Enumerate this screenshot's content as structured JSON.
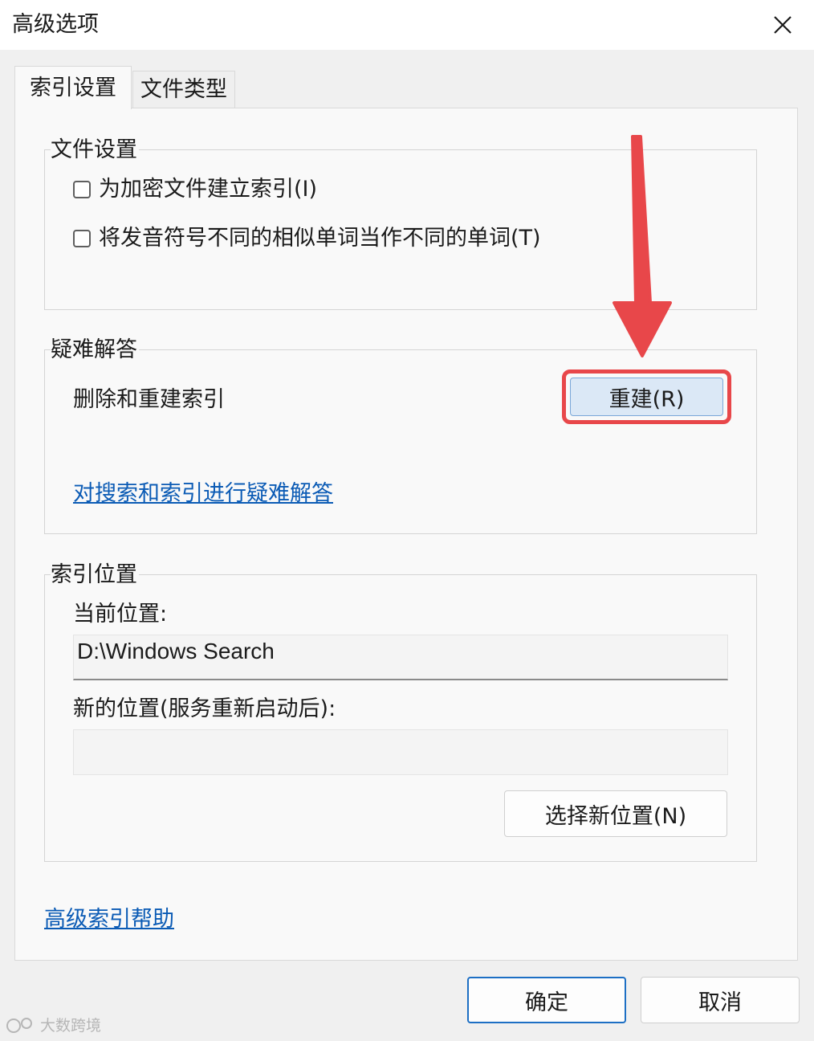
{
  "window": {
    "title": "高级选项"
  },
  "tabs": [
    {
      "label": "索引设置"
    },
    {
      "label": "文件类型"
    }
  ],
  "file_settings": {
    "legend": "文件设置",
    "options": [
      {
        "label": "为加密文件建立索引(I)",
        "checked": false
      },
      {
        "label": "将发音符号不同的相似单词当作不同的单词(T)",
        "checked": false
      }
    ]
  },
  "troubleshooting": {
    "legend": "疑难解答",
    "rebuild_text": "删除和重建索引",
    "rebuild_button": "重建(R)",
    "troubleshoot_link": "对搜索和索引进行疑难解答"
  },
  "index_location": {
    "legend": "索引位置",
    "current_label": "当前位置:",
    "current_value": "D:\\Windows Search",
    "new_label": "新的位置(服务重新启动后):",
    "new_value": "",
    "select_button": "选择新位置(N)"
  },
  "help_link": "高级索引帮助",
  "footer": {
    "ok_button": "确定",
    "cancel_button": "取消"
  },
  "watermark": "大数跨境",
  "colors": {
    "highlight": "#e8474a",
    "link": "#0b5bb5",
    "accent_button_bg": "#dbe8f6"
  }
}
